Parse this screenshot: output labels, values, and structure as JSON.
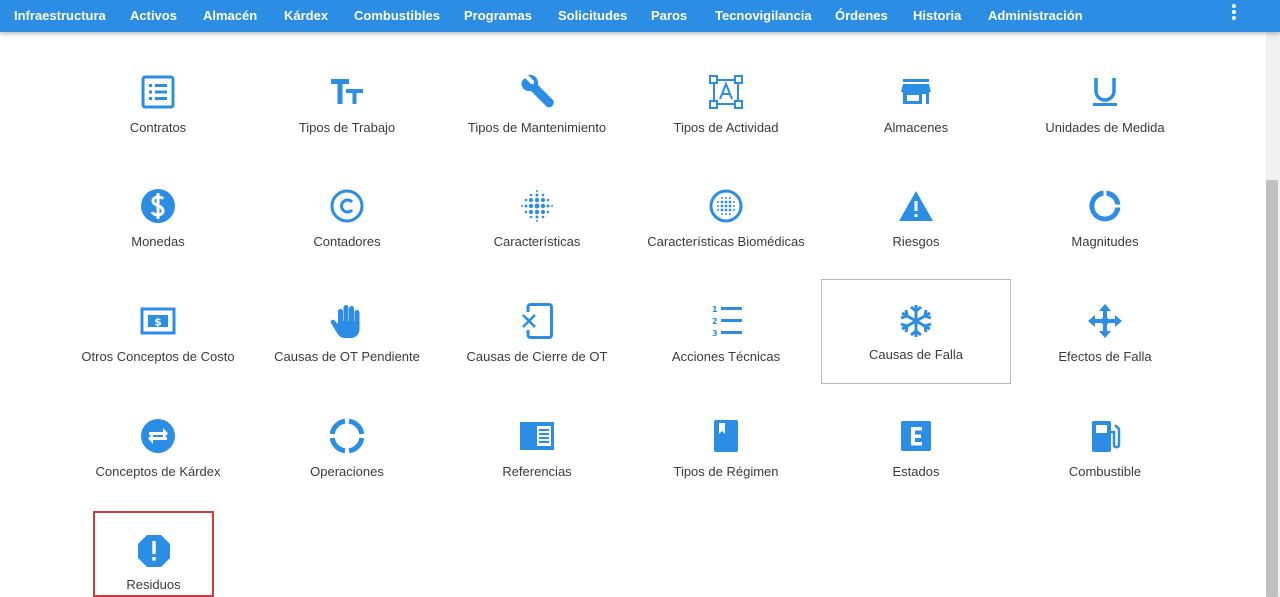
{
  "nav": {
    "items": [
      "Infraestructura",
      "Activos",
      "Almacén",
      "Kárdex",
      "Combustibles",
      "Programas",
      "Solicitudes",
      "Paros",
      "Tecnovigilancia",
      "Órdenes",
      "Historia",
      "Administración"
    ],
    "menu_icon": "more-vert-icon",
    "bg_color": "#2b8de3"
  },
  "accent_color": "#2b8de3",
  "tiles": [
    {
      "label": "Contratos",
      "icon": "list-alt-icon"
    },
    {
      "label": "Tipos de Trabajo",
      "icon": "text-fields-icon"
    },
    {
      "label": "Tipos de Mantenimiento",
      "icon": "wrench-icon"
    },
    {
      "label": "Tipos de Actividad",
      "icon": "format-shapes-icon"
    },
    {
      "label": "Almacenes",
      "icon": "store-icon"
    },
    {
      "label": "Unidades de Medida",
      "icon": "underline-icon"
    },
    {
      "label": "Monedas",
      "icon": "dollar-circle-icon"
    },
    {
      "label": "Contadores",
      "icon": "copyright-icon"
    },
    {
      "label": "Características",
      "icon": "blur-dots-icon"
    },
    {
      "label": "Características Biomédicas",
      "icon": "blur-circle-icon"
    },
    {
      "label": "Riesgos",
      "icon": "warning-icon"
    },
    {
      "label": "Magnitudes",
      "icon": "donut-icon"
    },
    {
      "label": "Otros Conceptos de Costo",
      "icon": "money-icon"
    },
    {
      "label": "Causas de OT Pendiente",
      "icon": "hand-stop-icon"
    },
    {
      "label": "Causas de Cierre de OT",
      "icon": "phone-close-icon"
    },
    {
      "label": "Acciones Técnicas",
      "icon": "numbered-list-icon"
    },
    {
      "label": "Causas de Falla",
      "icon": "snowflake-icon"
    },
    {
      "label": "Efectos de Falla",
      "icon": "arrows-all-icon"
    },
    {
      "label": "Conceptos de Kárdex",
      "icon": "swap-circle-icon"
    },
    {
      "label": "Operaciones",
      "icon": "segmented-circle-icon"
    },
    {
      "label": "Referencias",
      "icon": "reader-icon"
    },
    {
      "label": "Tipos de Régimen",
      "icon": "book-icon"
    },
    {
      "label": "Estados",
      "icon": "letter-e-box-icon"
    },
    {
      "label": "Combustible",
      "icon": "gas-pump-icon"
    },
    {
      "label": "Residuos",
      "icon": "alert-octagon-icon"
    }
  ],
  "hovered_tile": "Causas de Falla",
  "selected_tile": "Residuos"
}
